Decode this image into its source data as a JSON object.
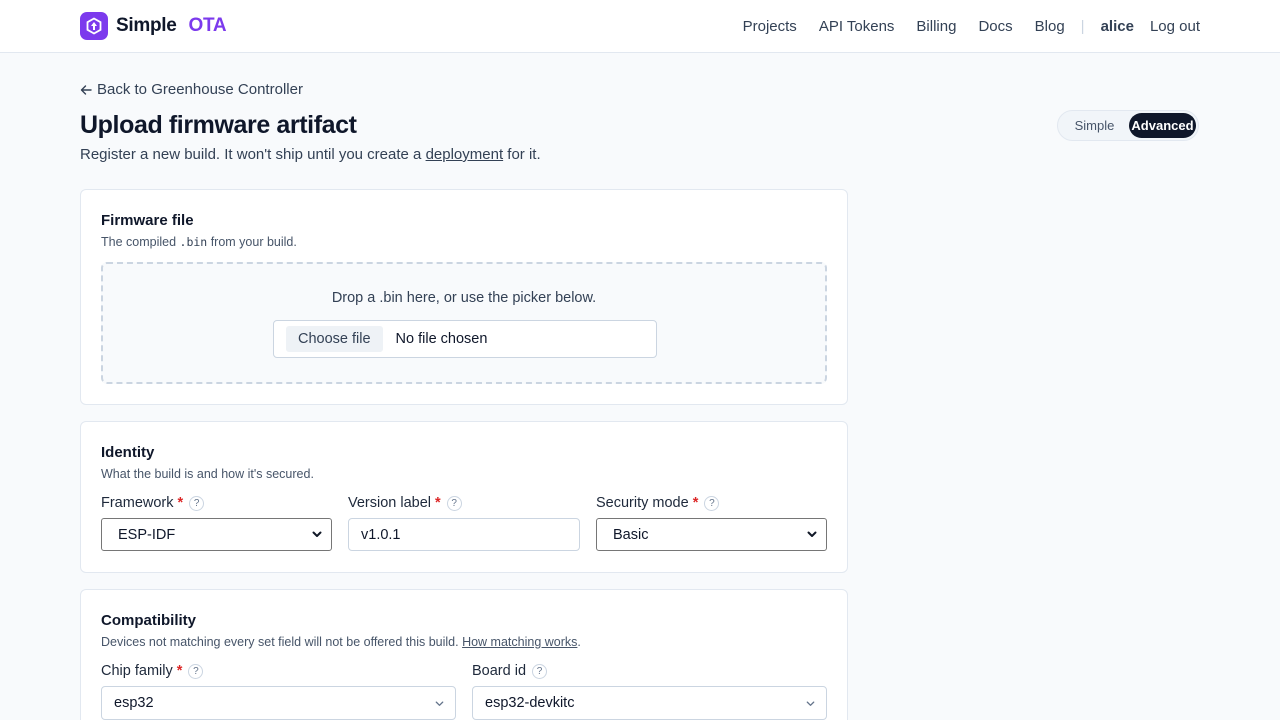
{
  "header": {
    "brand_name": "Simple",
    "brand_accent": "OTA",
    "nav": [
      "Projects",
      "API Tokens",
      "Billing",
      "Docs",
      "Blog"
    ],
    "separator": "|",
    "user": "alice",
    "logout": "Log out"
  },
  "page": {
    "back_label": "Back to Greenhouse Controller",
    "title": "Upload firmware artifact",
    "subtitle_pre": "Register a new build. It won't ship until you create a ",
    "subtitle_link": "deployment",
    "subtitle_post": " for it.",
    "mode_options": [
      "Simple",
      "Advanced"
    ],
    "mode_selected": "Advanced"
  },
  "firmware_card": {
    "title": "Firmware file",
    "desc_pre": "The compiled ",
    "desc_code": ".bin",
    "desc_post": " from your build.",
    "drop_text": "Drop a .bin here, or use the picker below.",
    "choose_label": "Choose file",
    "file_status": "No file chosen"
  },
  "identity_card": {
    "title": "Identity",
    "desc": "What the build is and how it's secured.",
    "framework_label": "Framework",
    "framework_value": "ESP-IDF",
    "version_label": "Version label",
    "version_value": "v1.0.1",
    "security_label": "Security mode",
    "security_value": "Basic"
  },
  "compat_card": {
    "title": "Compatibility",
    "desc_pre": "Devices not matching every set field will not be offered this build. ",
    "desc_link": "How matching works",
    "desc_post": ".",
    "chip_label": "Chip family",
    "chip_value": "esp32",
    "board_label": "Board id",
    "board_value": "esp32-devkitc"
  },
  "common": {
    "required_mark": "*",
    "help_mark": "?"
  },
  "colors": {
    "accent": "#7c3aed",
    "required": "#dc2626",
    "dark": "#0f172a"
  },
  "icons": [
    "logo-icon",
    "arrow-left-icon",
    "help-icon",
    "chevron-down-icon"
  ]
}
